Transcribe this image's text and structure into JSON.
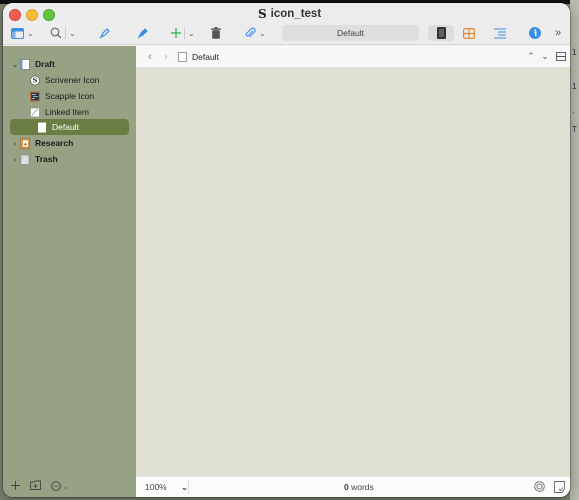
{
  "window": {
    "title": "icon_test",
    "app_icon": "scrivener-s-icon"
  },
  "toolbar": {
    "items": [
      {
        "name": "view-mode",
        "icon": "sidebar-layout-icon",
        "has_menu": true
      },
      {
        "name": "search",
        "icon": "magnifier-icon",
        "has_menu": true
      },
      {
        "name": "quick-reference",
        "icon": "pen-nib-icon"
      },
      {
        "name": "inspector-pen",
        "icon": "pen-nib-filled-icon"
      },
      {
        "name": "add",
        "icon": "plus-icon",
        "has_menu": true
      },
      {
        "name": "trash",
        "icon": "trash-icon"
      },
      {
        "name": "attach",
        "icon": "paperclip-icon",
        "has_menu": true
      }
    ],
    "title_field": "Default",
    "view_buttons": [
      {
        "name": "scrivenings",
        "icon": "document-lines-icon",
        "active": true
      },
      {
        "name": "corkboard",
        "icon": "corkboard-grid-icon"
      },
      {
        "name": "outliner",
        "icon": "outline-lines-icon"
      }
    ],
    "inspector_icon": "info-icon",
    "overflow_icon": "double-chevron-right-icon"
  },
  "binder": {
    "items": [
      {
        "label": "Draft",
        "level": 0,
        "expanded": true,
        "bold": true,
        "icon": "draft-folder-icon"
      },
      {
        "label": "Scrivener Icon",
        "level": 1,
        "icon": "scrivener-icon"
      },
      {
        "label": "Scapple Icon",
        "level": 1,
        "icon": "scapple-icon"
      },
      {
        "label": "Linked Item",
        "level": 1,
        "icon": "linked-image-icon"
      },
      {
        "label": "Default",
        "level": 1,
        "selected": true,
        "icon": "blank-document-icon"
      },
      {
        "label": "Research",
        "level": 0,
        "expanded": false,
        "bold": true,
        "icon": "research-folder-icon"
      },
      {
        "label": "Trash",
        "level": 0,
        "expanded": false,
        "bold": true,
        "icon": "trash-folder-icon"
      }
    ],
    "footer": {
      "add_icon": "plus-icon",
      "add_folder_icon": "add-folder-icon",
      "more_icon": "ellipsis-circle-icon"
    }
  },
  "editor": {
    "header": {
      "doc_title": "Default",
      "back_icon": "chevron-left-icon",
      "forward_icon": "chevron-right-icon",
      "up_icon": "chevron-up-icon",
      "down_icon": "chevron-down-icon",
      "split_icon": "split-editor-icon"
    },
    "footer": {
      "zoom": "100%",
      "word_count_number": "0",
      "word_count_label": "words",
      "target_icon": "target-icon",
      "notes_icon": "document-check-icon"
    }
  },
  "colors": {
    "sidebar_bg": "#97a284",
    "selection": "#6a7d43",
    "editor_bg": "#e0e0d2",
    "accent_blue": "#3a8ee6",
    "add_green": "#3fb55a",
    "corkboard_orange": "#e0893a"
  }
}
